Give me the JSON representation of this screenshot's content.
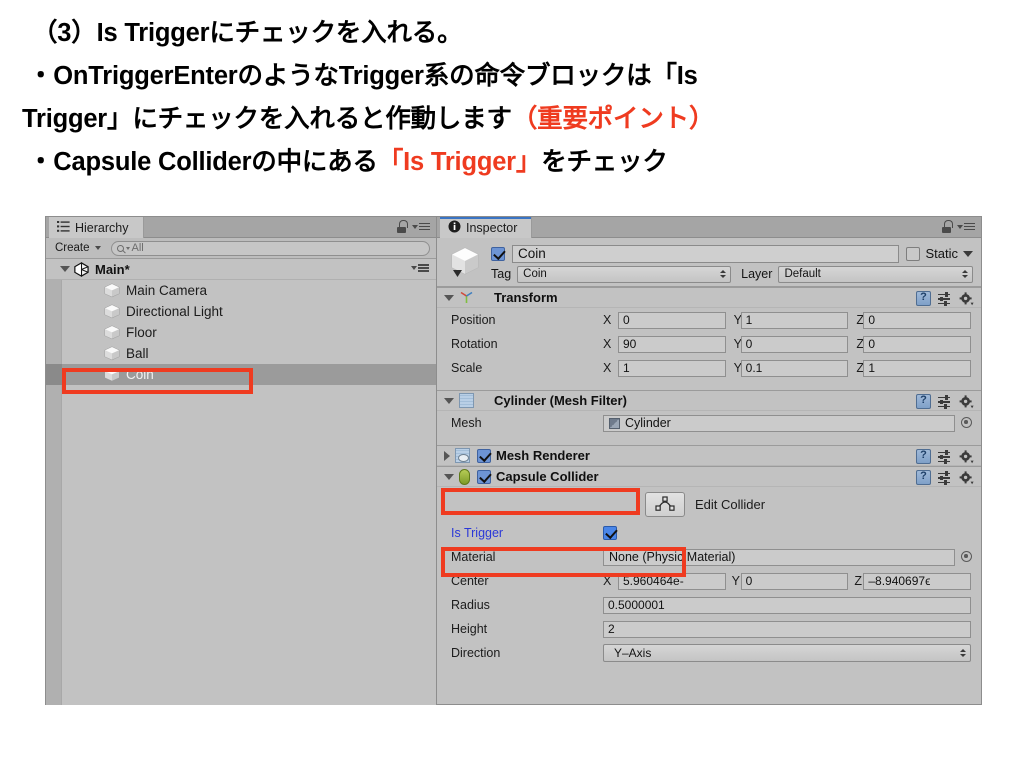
{
  "caption": {
    "line1": "（3）Is Triggerにチェックを入れる。",
    "line2": "・OnTriggerEnterのようなTrigger系の命令ブロックは「Is",
    "line3_a": "Trigger」にチェックを入れると作動します",
    "line3_b": "（重要ポイント）",
    "line4_a": "・Capsule Colliderの中にある",
    "line4_b": "「Is Trigger」",
    "line4_c": "をチェック"
  },
  "colors": {
    "annotation_red": "#ef3b20",
    "focus_blue": "#3a74c4",
    "modified_label_blue": "#2b38d8",
    "panel_gray": "#c2c2c2"
  },
  "hierarchy": {
    "tab_label": "Hierarchy",
    "tab_icon": "hierarchy-list-icon",
    "lock_icon": "lock-icon",
    "menu_icon": "panel-menu-icon",
    "create_button": "Create",
    "search_placeholder": "All",
    "search_value": "",
    "scene": {
      "name": "Main*",
      "icon": "unity-logo-icon",
      "expanded": true
    },
    "items": [
      {
        "label": "Main Camera",
        "icon": "gameobject-cube-icon",
        "selected": false
      },
      {
        "label": "Directional Light",
        "icon": "gameobject-cube-icon",
        "selected": false
      },
      {
        "label": "Floor",
        "icon": "gameobject-cube-icon",
        "selected": false
      },
      {
        "label": "Ball",
        "icon": "gameobject-cube-icon",
        "selected": false
      },
      {
        "label": "Coin",
        "icon": "gameobject-cube-icon",
        "selected": true
      }
    ]
  },
  "inspector": {
    "tab_label": "Inspector",
    "tab_icon": "info-icon",
    "lock_icon": "lock-icon",
    "menu_icon": "panel-menu-icon",
    "object": {
      "icon": "gameobject-cube-icon",
      "enabled": true,
      "name": "Coin",
      "static_label": "Static",
      "static_checked": false,
      "tag_label": "Tag",
      "tag_value": "Coin",
      "layer_label": "Layer",
      "layer_value": "Default"
    },
    "components": [
      {
        "title": "Transform",
        "icon": "transform-axis-icon",
        "expanded": true,
        "has_checkbox": false,
        "rows": [
          {
            "label": "Position",
            "type": "vector3",
            "x": "0",
            "y": "1",
            "z": "0"
          },
          {
            "label": "Rotation",
            "type": "vector3",
            "x": "90",
            "y": "0",
            "z": "0"
          },
          {
            "label": "Scale",
            "type": "vector3",
            "x": "1",
            "y": "0.1",
            "z": "1"
          }
        ]
      },
      {
        "title": "Cylinder (Mesh Filter)",
        "icon": "mesh-filter-icon",
        "expanded": true,
        "has_checkbox": false,
        "rows": [
          {
            "label": "Mesh",
            "type": "object",
            "value": "Cylinder",
            "value_icon": "mesh-asset-icon"
          }
        ]
      },
      {
        "title": "Mesh Renderer",
        "icon": "mesh-renderer-icon",
        "expanded": false,
        "has_checkbox": true,
        "checked": true,
        "rows": []
      },
      {
        "title": "Capsule Collider",
        "icon": "capsule-collider-icon",
        "expanded": true,
        "has_checkbox": true,
        "checked": true,
        "edit_collider_label": "Edit Collider",
        "edit_collider_icon": "edit-collider-icon",
        "rows": [
          {
            "label": "Is Trigger",
            "type": "checkbox",
            "checked": true,
            "highlighted": true
          },
          {
            "label": "Material",
            "type": "object",
            "value": "None (Physic Material)"
          },
          {
            "label": "Center",
            "type": "vector3",
            "x": "5.960464e-",
            "y": "0",
            "z": "–8.940697ϵ"
          },
          {
            "label": "Radius",
            "type": "text",
            "value": "0.5000001"
          },
          {
            "label": "Height",
            "type": "text",
            "value": "2"
          },
          {
            "label": "Direction",
            "type": "popup",
            "value": "Y–Axis"
          }
        ]
      }
    ],
    "axis_labels": {
      "x": "X",
      "y": "Y",
      "z": "Z"
    }
  },
  "annotations": [
    {
      "name": "coin-hierarchy-highlight",
      "target": "hierarchy Coin row"
    },
    {
      "name": "capsule-collider-header-highlight",
      "target": "Capsule Collider header"
    },
    {
      "name": "is-trigger-highlight",
      "target": "Is Trigger row"
    }
  ]
}
